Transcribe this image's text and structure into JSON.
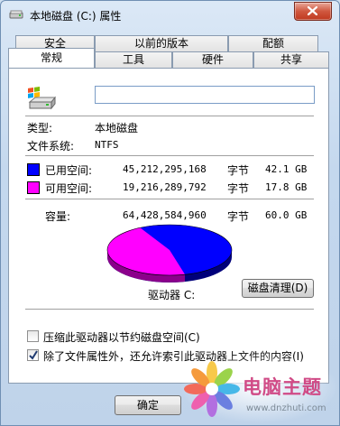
{
  "window": {
    "title": "本地磁盘 (C:) 属性"
  },
  "tabs": {
    "row1": [
      "安全",
      "以前的版本",
      "配额"
    ],
    "row2": [
      "常规",
      "工具",
      "硬件",
      "共享"
    ]
  },
  "general": {
    "name_value": "",
    "type_label": "类型:",
    "type_value": "本地磁盘",
    "fs_label": "文件系统:",
    "fs_value": "NTFS",
    "used": {
      "label": "已用空间:",
      "bytes": "45,212,295,168",
      "unit": "字节",
      "human": "42.1 GB",
      "color": "#0000ff"
    },
    "free": {
      "label": "可用空间:",
      "bytes": "19,216,289,792",
      "unit": "字节",
      "human": "17.8 GB",
      "color": "#ff00ff"
    },
    "capacity": {
      "label": "容量:",
      "bytes": "64,428,584,960",
      "unit": "字节",
      "human": "60.0 GB"
    },
    "drive_label": "驱动器 C:",
    "cleanup_button": "磁盘清理(D)",
    "compress": {
      "label": "压缩此驱动器以节约磁盘空间(C)",
      "checked": false
    },
    "index": {
      "label": "除了文件属性外，还允许索引此驱动器上文件的内容(I)",
      "checked": true
    }
  },
  "footer": {
    "ok_button": "确定"
  },
  "watermark": {
    "title": "电脑主题",
    "url": "www.dnzhuti.com"
  },
  "icons": {
    "title": "drive-icon",
    "close": "close-icon",
    "drive": "windows-drive-icon",
    "check": "checkmark-icon",
    "watermark": "flower-logo-icon"
  }
}
